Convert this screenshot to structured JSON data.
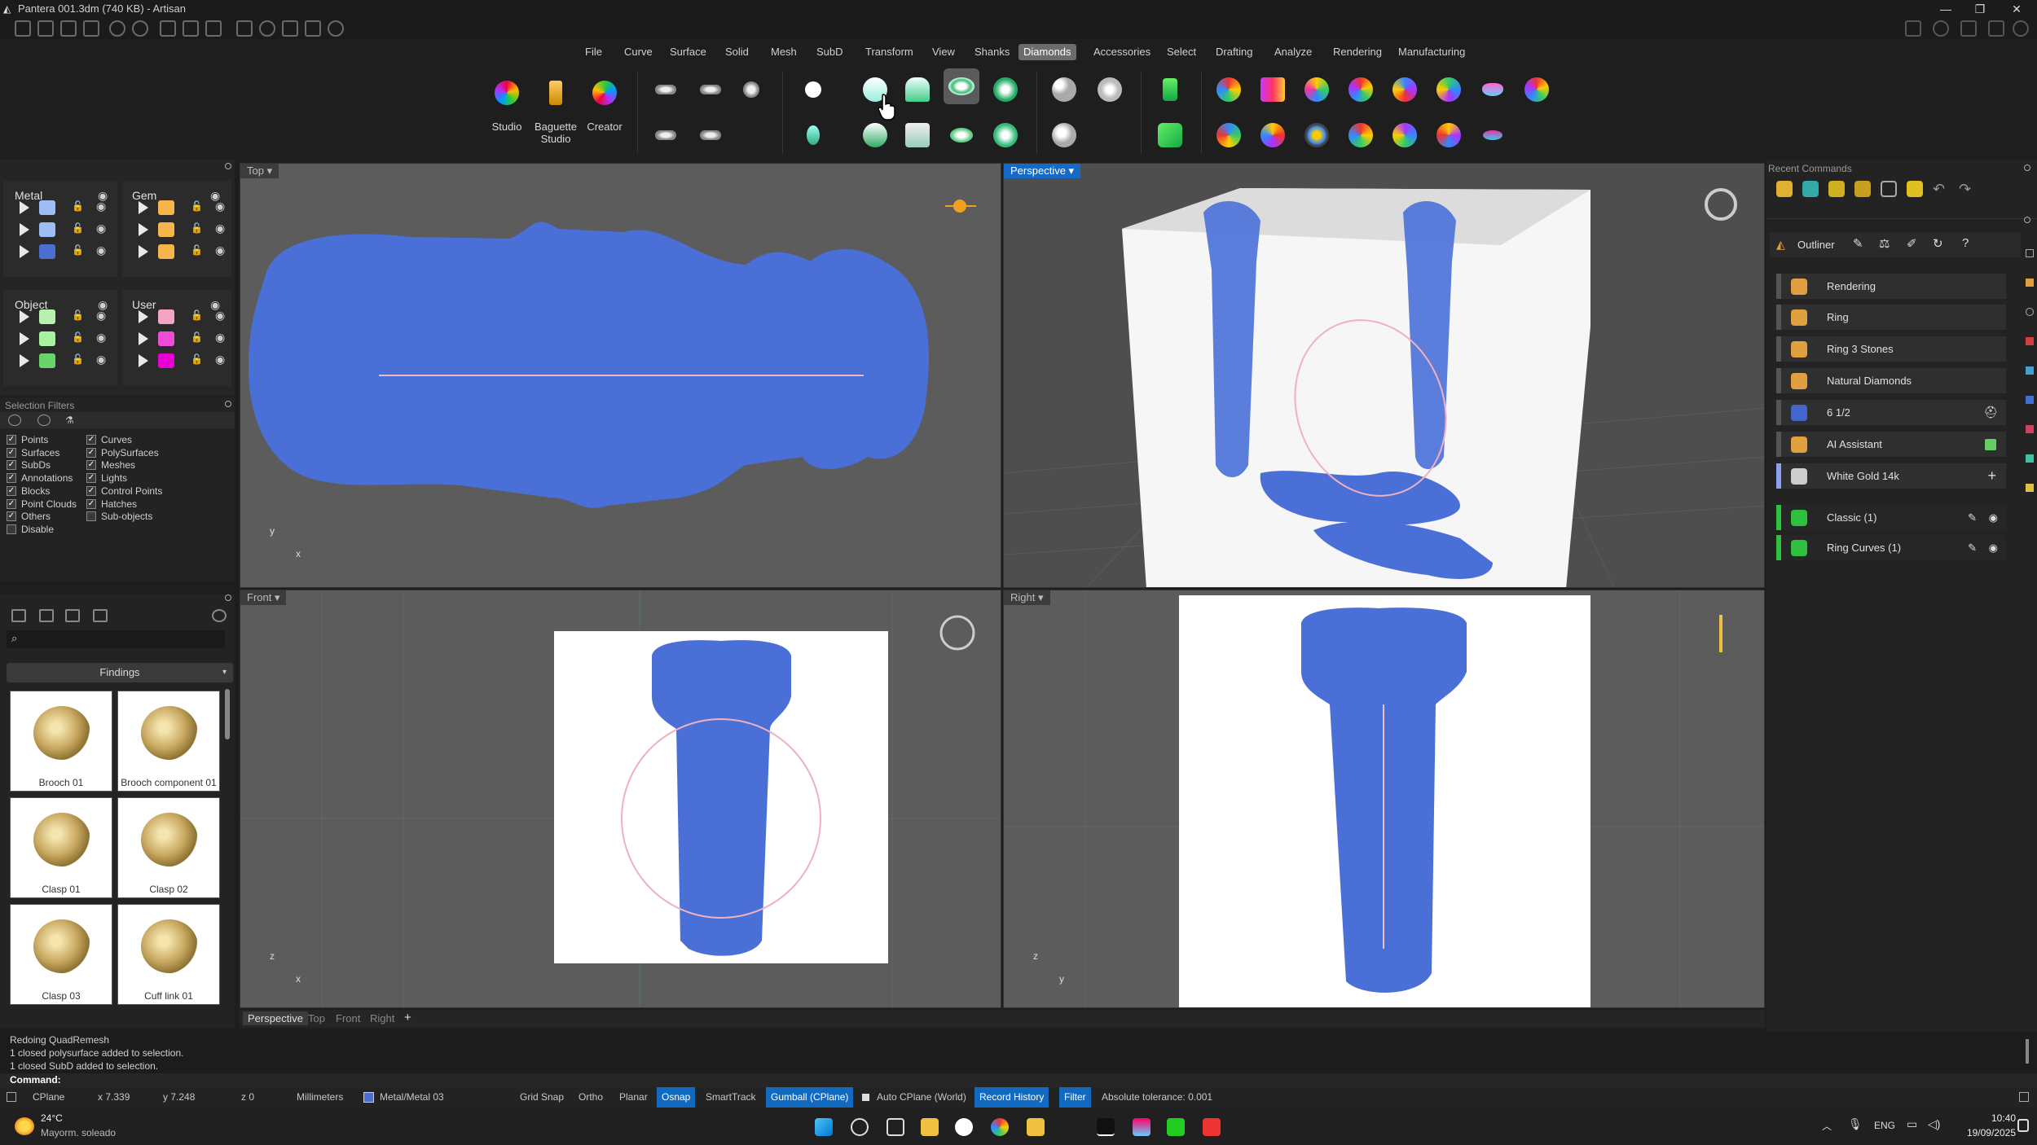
{
  "title": "Pantera 001.3dm (740 KB) - Artisan",
  "window_controls": {
    "minimize": "—",
    "restore": "❐",
    "close": "✕"
  },
  "menu": [
    "File",
    "Curve",
    "Surface",
    "Solid",
    "Mesh",
    "SubD",
    "Transform",
    "View",
    "Shanks",
    "Diamonds",
    "Accessories",
    "Select",
    "Drafting",
    "Analyze",
    "Rendering",
    "Manufacturing"
  ],
  "menu_active": "Diamonds",
  "ribbon": {
    "studio": "Studio",
    "baguette_studio": "Baguette\nStudio",
    "creator": "Creator"
  },
  "layers": {
    "metal": {
      "title": "Metal",
      "colors": [
        "#9dbdf4",
        "#9dbdf4",
        "#4a6fd0"
      ]
    },
    "gem": {
      "title": "Gem",
      "colors": [
        "#f5b54a",
        "#f5b54a",
        "#f5b54a"
      ]
    },
    "object": {
      "title": "Object",
      "colors": [
        "#b8f2b0",
        "#a6f2a0",
        "#69d46a"
      ]
    },
    "user": {
      "title": "User",
      "colors": [
        "#f4a4c4",
        "#f04cd8",
        "#e600d4"
      ]
    }
  },
  "selection_filters": {
    "title": "Selection Filters",
    "left": [
      {
        "label": "Points",
        "checked": true
      },
      {
        "label": "Surfaces",
        "checked": true
      },
      {
        "label": "SubDs",
        "checked": true
      },
      {
        "label": "Annotations",
        "checked": true
      },
      {
        "label": "Blocks",
        "checked": true
      },
      {
        "label": "Point Clouds",
        "checked": true
      },
      {
        "label": "Others",
        "checked": true
      },
      {
        "label": "Disable",
        "checked": false
      }
    ],
    "right": [
      {
        "label": "Curves",
        "checked": true
      },
      {
        "label": "PolySurfaces",
        "checked": true
      },
      {
        "label": "Meshes",
        "checked": true
      },
      {
        "label": "Lights",
        "checked": true
      },
      {
        "label": "Control Points",
        "checked": true
      },
      {
        "label": "Hatches",
        "checked": true
      },
      {
        "label": "Sub-objects",
        "checked": false
      }
    ]
  },
  "library": {
    "category": "Findings",
    "items": [
      "Brooch 01",
      "Brooch component 01",
      "Clasp 01",
      "Clasp 02",
      "Clasp 03",
      "Cuff link 01"
    ]
  },
  "viewports": {
    "top": "Top",
    "perspective": "Perspective",
    "front": "Front",
    "right": "Right"
  },
  "axes": {
    "x": "x",
    "y": "y",
    "z": "z"
  },
  "viewport_tabs": [
    "Perspective",
    "Top",
    "Front",
    "Right",
    "+"
  ],
  "recent_commands": {
    "title": "Recent Commands"
  },
  "outliner": {
    "title": "Outliner",
    "items": [
      {
        "label": "Rendering",
        "icon_color": "#e0a040",
        "bar": "#555"
      },
      {
        "label": "Ring",
        "icon_color": "#e0a040",
        "bar": "#555"
      },
      {
        "label": "Ring 3 Stones",
        "icon_color": "#e0a040",
        "bar": "#555"
      },
      {
        "label": "Natural Diamonds",
        "icon_color": "#e0a040",
        "bar": "#555"
      },
      {
        "label": "6 1/2",
        "icon_color": "#4466cc",
        "bar": "#555"
      },
      {
        "label": "AI Assistant",
        "icon_color": "#e0a040",
        "bar": "#555"
      },
      {
        "label": "White Gold 14k",
        "icon_color": "#cccccc",
        "bar": "#8aa0f0"
      },
      {
        "label": "Classic (1)",
        "icon_color": "#30c040",
        "bar": "#30c040"
      },
      {
        "label": "Ring Curves (1)",
        "icon_color": "#30c040",
        "bar": "#30c040"
      }
    ]
  },
  "command_history": [
    "Redoing QuadRemesh",
    "1 closed polysurface added to selection.",
    "1 closed SubD added to selection."
  ],
  "command_prompt": "Command:",
  "status": {
    "cplane": "CPlane",
    "x": "x 7.339",
    "y": "y 7.248",
    "z": "z 0",
    "units": "Millimeters",
    "layer": "Metal/Metal 03",
    "grid_snap": "Grid Snap",
    "ortho": "Ortho",
    "planar": "Planar",
    "osnap": "Osnap",
    "smarttrack": "SmartTrack",
    "gumball": "Gumball (CPlane)",
    "auto_cplane": "Auto CPlane (World)",
    "record_history": "Record History",
    "filter": "Filter",
    "tolerance": "Absolute tolerance: 0.001"
  },
  "taskbar": {
    "temp": "24°C",
    "weather": "Mayorm. soleado",
    "lang": "ENG",
    "time": "10:40",
    "date": "19/09/2025"
  }
}
